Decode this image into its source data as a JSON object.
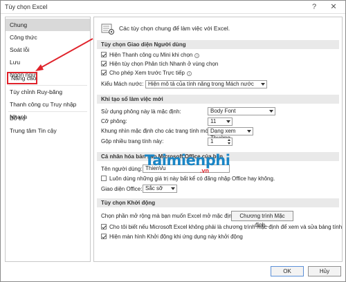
{
  "window": {
    "title": "Tùy chọn Excel",
    "help_icon": "?",
    "close_icon": "✕"
  },
  "sidebar": {
    "items": [
      {
        "label": "Chung"
      },
      {
        "label": "Công thức"
      },
      {
        "label": "Soát lỗi"
      },
      {
        "label": "Lưu"
      },
      {
        "label": "Ngôn ngữ"
      },
      {
        "label": "Nâng cao"
      },
      {
        "label": "Tùy chỉnh Ruy-băng"
      },
      {
        "label": "Thanh công cụ Truy nhập Nhanh"
      },
      {
        "label": "Bổ trợ"
      },
      {
        "label": "Trung tâm Tin cậy"
      }
    ],
    "selected_index": 0,
    "highlighted_index": 5
  },
  "content": {
    "header_text": "Các tùy chọn chung để làm việc với Excel.",
    "ui_section": {
      "title": "Tùy chọn Giao diện Người dùng",
      "options": [
        {
          "label": "Hiện Thanh công cụ Mini khi chọn",
          "checked": true,
          "info": true
        },
        {
          "label": "Hiện tùy chọn Phân tích Nhanh ở vùng chọn",
          "checked": true,
          "info": false
        },
        {
          "label": "Cho phép Xem trước Trực tiếp",
          "checked": true,
          "info": true
        }
      ],
      "tooltip_label": "Kiểu Mách nước:",
      "tooltip_value": "Hiện mô tả của tính năng trong Mách nước"
    },
    "new_workbook_section": {
      "title": "Khi tạo sổ làm việc mới",
      "font_label": "Sử dụng phông này là mặc định:",
      "font_value": "Body Font",
      "size_label": "Cỡ phông:",
      "size_value": "11",
      "view_label": "Khung nhìn mặc định cho các trang tính mới:",
      "view_value": "Dạng xem Thường",
      "sheets_label": "Gộp nhiều trang tính này:",
      "sheets_value": "1"
    },
    "personalize_section": {
      "title": "Cá nhân hóa bản sao Microsoft Office của bạn",
      "username_label": "Tên người dùng:",
      "username_value": "ThienVu",
      "always_label": "Luôn dùng những giá trị này bất kể có đăng nhập Office hay không.",
      "always_checked": false,
      "theme_label": "Giao diện Office:",
      "theme_value": "Sắc sỡ"
    },
    "startup_section": {
      "title": "Tùy chọn Khởi động",
      "default_prog_label": "Chọn phần mở rộng mà bạn muốn Excel mở mặc định:",
      "default_prog_button": "Chương trình Mặc định...",
      "tell_me_label": "Cho tôi biết nếu Microsoft Excel không phải là chương trình mặc định để xem và sửa bảng tính.",
      "tell_me_checked": true,
      "show_start_label": "Hiện màn hình Khởi động khi ứng dụng này khởi động",
      "show_start_checked": true
    }
  },
  "footer": {
    "ok_label": "OK",
    "cancel_label": "Hủy"
  },
  "watermark": {
    "main": "Taimienphi",
    "suffix": ".vn"
  },
  "colors": {
    "accent_red": "#e0232b",
    "selected_bg": "#d9d9d9",
    "section_bg": "#e9e9e9",
    "watermark_blue": "#1a86c6"
  }
}
